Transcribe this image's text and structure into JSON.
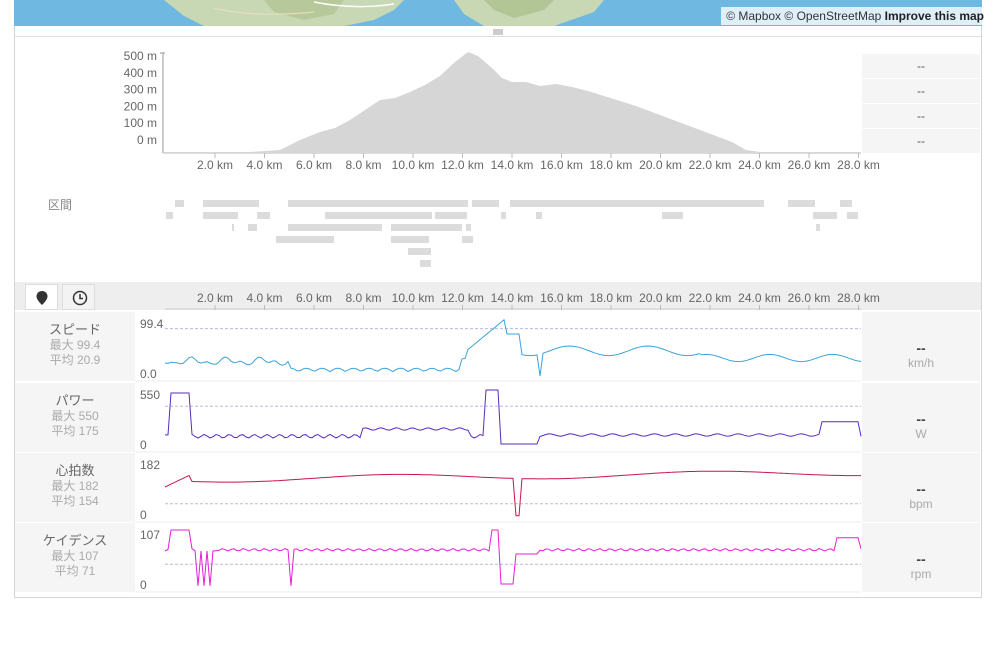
{
  "map": {
    "attribution_mapbox": "© Mapbox",
    "attribution_osm": "© OpenStreetMap",
    "improve_link": "Improve this map"
  },
  "elevation": {
    "y_ticks": [
      "500 m",
      "400 m",
      "300 m",
      "200 m",
      "100 m",
      "0 m"
    ],
    "stats": [
      "--",
      "--",
      "--",
      "--"
    ]
  },
  "x_axis_ticks": [
    "2.0 km",
    "4.0 km",
    "6.0 km",
    "8.0 km",
    "10.0 km",
    "12.0 km",
    "14.0 km",
    "16.0 km",
    "18.0 km",
    "20.0 km",
    "22.0 km",
    "24.0 km",
    "26.0 km",
    "28.0 km"
  ],
  "segments": {
    "label": "区間"
  },
  "tabs": [
    {
      "name": "location",
      "icon": "map-pin-icon"
    },
    {
      "name": "time",
      "icon": "clock-icon"
    }
  ],
  "streams": [
    {
      "key": "speed",
      "title": "スピード",
      "max_label": "最大 99.4",
      "avg_label": "平均 20.9",
      "y_max": "99.4",
      "y_min": "0.0",
      "value": "--",
      "unit": "km/h",
      "color": "#3aa3d9"
    },
    {
      "key": "power",
      "title": "パワー",
      "max_label": "最大 550",
      "avg_label": "平均 175",
      "y_max": "550",
      "y_min": "0",
      "value": "--",
      "unit": "W",
      "color": "#5a2bbf"
    },
    {
      "key": "heartrate",
      "title": "心拍数",
      "max_label": "最大 182",
      "avg_label": "平均 154",
      "y_max": "182",
      "y_min": "0",
      "value": "--",
      "unit": "bpm",
      "color": "#c8154b"
    },
    {
      "key": "cadence",
      "title": "ケイデンス",
      "max_label": "最大 107",
      "avg_label": "平均 71",
      "y_max": "107",
      "y_min": "0",
      "value": "--",
      "unit": "rpm",
      "color": "#e61fd6"
    }
  ]
}
